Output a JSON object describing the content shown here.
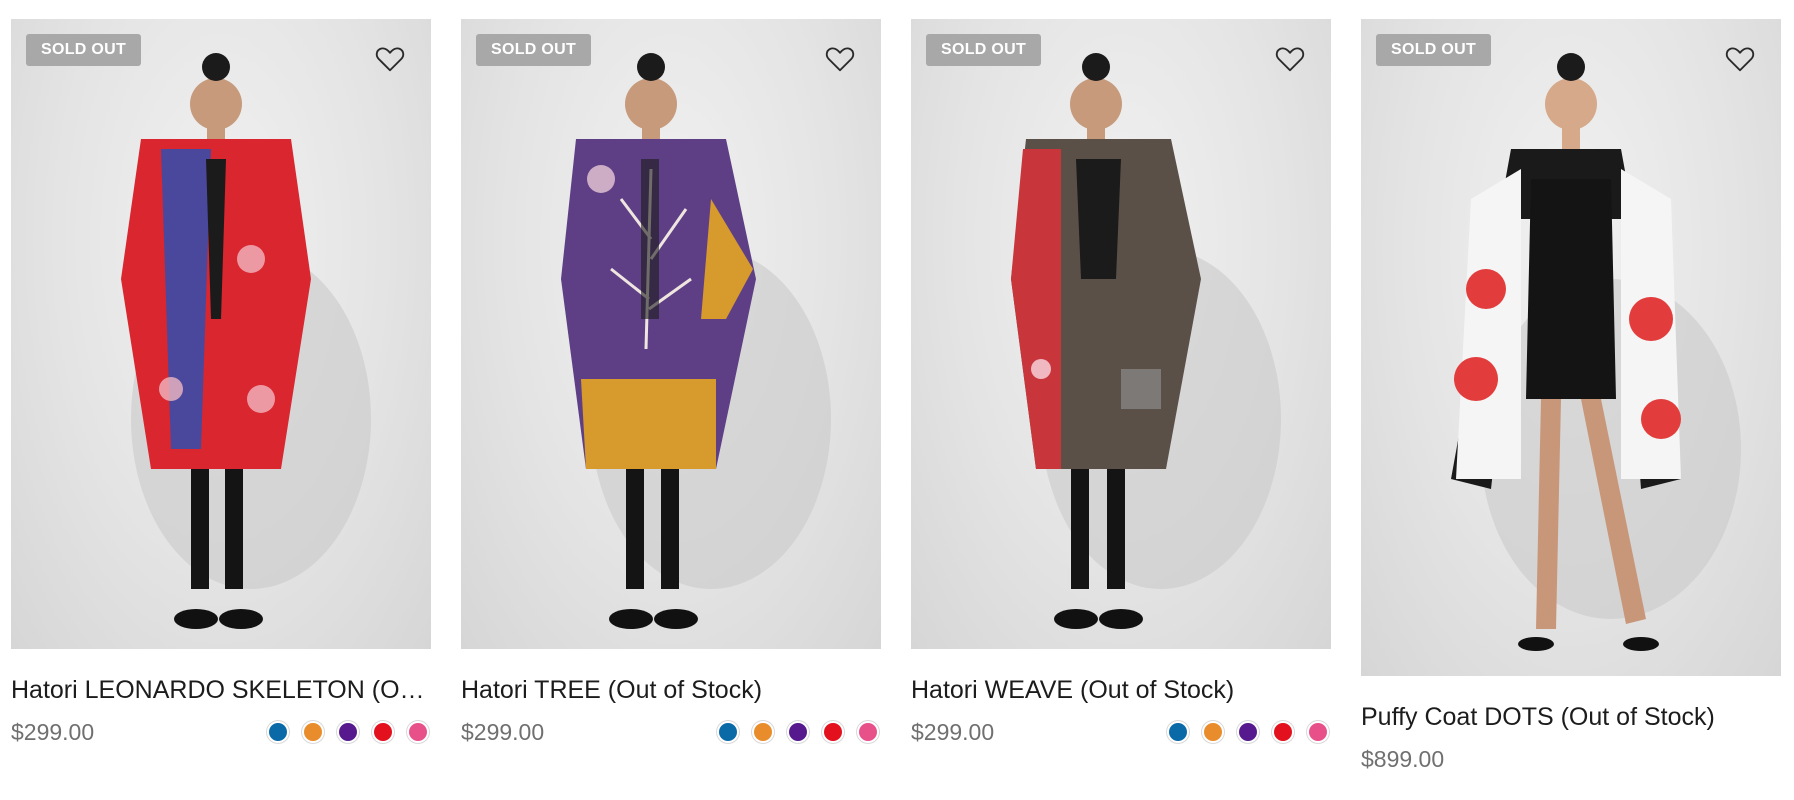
{
  "products": [
    {
      "badge": "SOLD OUT",
      "title": "Hatori LEONARDO SKELETON (Out of Stock)",
      "price": "$299.00",
      "garment_colors": [
        "#d9262f",
        "#2f4fb0",
        "#e2484f"
      ]
    },
    {
      "badge": "SOLD OUT",
      "title": "Hatori TREE (Out of Stock)",
      "price": "$299.00",
      "garment_colors": [
        "#5e3f86",
        "#d79a2c",
        "#4a3370"
      ]
    },
    {
      "badge": "SOLD OUT",
      "title": "Hatori WEAVE (Out of Stock)",
      "price": "$299.00",
      "garment_colors": [
        "#5a5048",
        "#c8363b",
        "#3b342f"
      ]
    },
    {
      "badge": "SOLD OUT",
      "title": "Puffy Coat DOTS (Out of Stock)",
      "price": "$899.00",
      "garment_colors": [
        "#f5f5f5",
        "#e23c3c",
        "#1a1a1a"
      ]
    }
  ],
  "swatch_colors": [
    "#0a6aa8",
    "#e98c2b",
    "#561a8e",
    "#e3101e",
    "#e8508a"
  ],
  "icons": {
    "wishlist": "heart-outline-icon"
  }
}
